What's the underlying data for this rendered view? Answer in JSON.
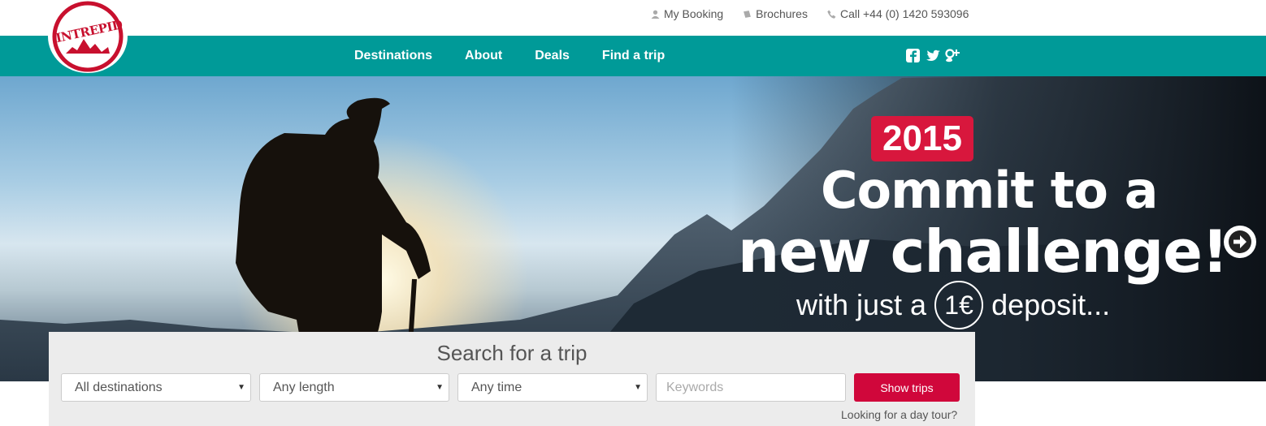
{
  "utility": {
    "links": [
      {
        "label": "My Booking",
        "icon": "user-icon"
      },
      {
        "label": "Brochures",
        "icon": "book-icon"
      },
      {
        "label": "Call +44 (0) 1420 593096",
        "icon": "phone-icon"
      }
    ]
  },
  "logo": {
    "text": "INTREPID"
  },
  "nav": {
    "items": [
      "Destinations",
      "About",
      "Deals",
      "Find a trip"
    ],
    "social": [
      "facebook-icon",
      "twitter-icon",
      "google-plus-icon"
    ]
  },
  "hero": {
    "year": "2015",
    "line1": "Commit to a",
    "line2": "new challenge!",
    "line3_before": "with just a",
    "line3_amount": "1€",
    "line3_after": "deposit..."
  },
  "search": {
    "title": "Search for a trip",
    "destination": "All destinations",
    "length": "Any length",
    "time": "Any time",
    "keywords_placeholder": "Keywords",
    "button": "Show trips",
    "day_tour": "Looking for a day tour?"
  },
  "colors": {
    "teal": "#009a98",
    "red": "#d0073b",
    "brand_red": "#c8102e"
  }
}
